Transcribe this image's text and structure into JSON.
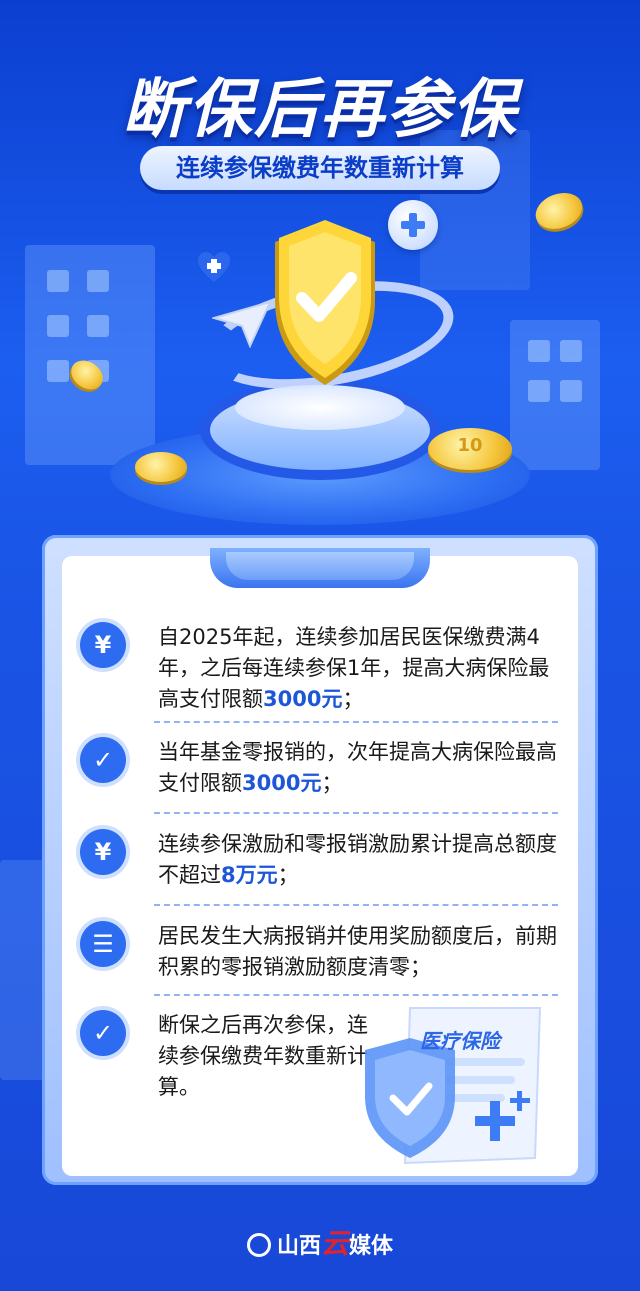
{
  "header": {
    "title": "断保后再参保",
    "subtitle": "连续参保缴费年数重新计算"
  },
  "illustration": {
    "coin_label": "10",
    "doc_label": "医疗保险"
  },
  "items": [
    {
      "icon": "yuan-icon",
      "icon_glyph": "¥",
      "text_before": "自2025年起，连续参加居民医保缴费满4年，之后每连续参保1年，提高大病保险最高支付限额",
      "highlight": "3000元",
      "text_after": "；"
    },
    {
      "icon": "check-icon",
      "icon_glyph": "✓",
      "text_before": "当年基金零报销的，次年提高大病保险最高支付限额",
      "highlight": "3000元",
      "text_after": "；"
    },
    {
      "icon": "yuan-icon",
      "icon_glyph": "¥",
      "text_before": "连续参保激励和零报销激励累计提高总额度不超过",
      "highlight": "8万元",
      "text_after": "；"
    },
    {
      "icon": "document-icon",
      "icon_glyph": "☰",
      "text_before": "居民发生大病报销并使用奖励额度后，前期积累的零报销激励额度清零；",
      "highlight": "",
      "text_after": ""
    },
    {
      "icon": "check-icon",
      "icon_glyph": "✓",
      "text_before": "断保之后再次参保，连续参保缴费年数重新计算。",
      "highlight": "",
      "text_after": ""
    }
  ],
  "footer": {
    "brand_pre": "山西",
    "brand_mid": "云",
    "brand_post": "媒体"
  },
  "colors": {
    "background": "#1c5ef0",
    "accent": "#2d6cf0",
    "highlight": "#1e56d8",
    "brand_red": "#e3232c"
  }
}
